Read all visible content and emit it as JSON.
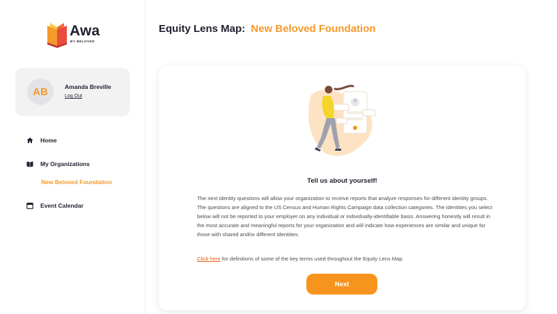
{
  "logo": {
    "word": "Awa",
    "sub": "BY BELOVED",
    "icon": "book-icon"
  },
  "user": {
    "initials": "AB",
    "name": "Amanda Breville",
    "logout_label": "Log Out"
  },
  "nav": {
    "home": {
      "label": "Home",
      "icon": "home-icon"
    },
    "orgs": {
      "label": "My Organizations",
      "icon": "book-icon"
    },
    "org_item": {
      "label": "New Beloved Foundation"
    },
    "calendar": {
      "label": "Event Calendar",
      "icon": "calendar-icon"
    }
  },
  "header": {
    "title_prefix": "Equity Lens Map:",
    "title_org": "New Beloved Foundation"
  },
  "card": {
    "heading": "Tell us about yourself!",
    "body": "The next identity questions will allow your organization to receive reports that analyze responses for different identity groups. The questions are aligned to the US Census and Human Rights Campaign data collection categories. The identities you select below will not be reported to your employer on any individual or individually-identifiable basis. Answering honestly will result in the most accurate and meaningful reports for your organization and will indicate how experiences are similar and unique for those with shared and/or different identities.",
    "link_text": "Click here",
    "link_suffix": " for definitions of some of the key terms used throughout the Equity Lens Map.",
    "next_label": "Next"
  },
  "colors": {
    "accent": "#f39a2a",
    "button": "#f7941d",
    "link": "#e2621b",
    "text": "#1f1f2e"
  }
}
